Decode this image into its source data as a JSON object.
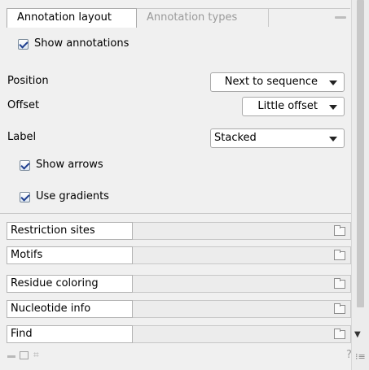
{
  "tabs": {
    "active": "Annotation layout",
    "inactive": "Annotation types"
  },
  "annotation_layout": {
    "show_annotations": {
      "label": "Show annotations",
      "checked": true
    },
    "position": {
      "label": "Position",
      "value": "Next to sequence"
    },
    "offset": {
      "label": "Offset",
      "value": "Little offset"
    },
    "label": {
      "label": "Label",
      "value": "Stacked"
    },
    "show_arrows": {
      "label": "Show arrows",
      "checked": true
    },
    "use_gradients": {
      "label": "Use gradients",
      "checked": true
    }
  },
  "sections": [
    "Restriction sites",
    "Motifs",
    "Residue coloring",
    "Nucleotide info",
    "Find"
  ],
  "bottom": {
    "help": "?"
  },
  "icons": [
    "minimize-icon",
    "folder-icon",
    "dropdown-arrow-icon",
    "collapse-all-icon",
    "expand-all-icon",
    "dock-icon",
    "help-icon",
    "settings-grip-icon",
    "scroll-down-icon"
  ]
}
